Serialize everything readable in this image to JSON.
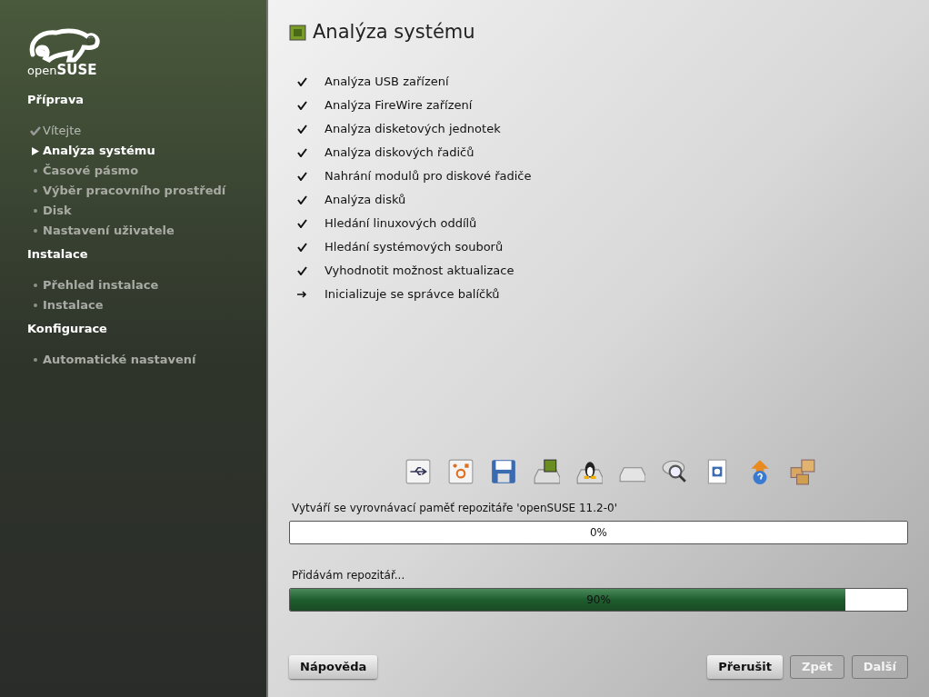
{
  "sidebar": {
    "logo_text": {
      "light": "open",
      "bold": "SUSE"
    },
    "sections": [
      {
        "title": "Příprava",
        "items": [
          {
            "label": "Vítejte",
            "kind": "done"
          },
          {
            "label": "Analýza systému",
            "kind": "current"
          },
          {
            "label": "Časové pásmo",
            "kind": "pending"
          },
          {
            "label": "Výběr pracovního prostředí",
            "kind": "pending"
          },
          {
            "label": "Disk",
            "kind": "pending"
          },
          {
            "label": "Nastavení uživatele",
            "kind": "pending"
          }
        ]
      },
      {
        "title": "Instalace",
        "items": [
          {
            "label": "Přehled instalace",
            "kind": "pending"
          },
          {
            "label": "Instalace",
            "kind": "pending"
          }
        ]
      },
      {
        "title": "Konfigurace",
        "items": [
          {
            "label": "Automatické nastavení",
            "kind": "pending"
          }
        ]
      }
    ]
  },
  "page": {
    "title": "Analýza systému",
    "steps": [
      {
        "label": "Analýza USB zařízení",
        "kind": "done"
      },
      {
        "label": "Analýza FireWire zařízení",
        "kind": "done"
      },
      {
        "label": "Analýza disketových jednotek",
        "kind": "done"
      },
      {
        "label": "Analýza diskových řadičů",
        "kind": "done"
      },
      {
        "label": "Nahrání modulů pro diskové řadiče",
        "kind": "done"
      },
      {
        "label": "Analýza disků",
        "kind": "done"
      },
      {
        "label": "Hledání linuxových oddílů",
        "kind": "done"
      },
      {
        "label": "Hledání systémových souborů",
        "kind": "done"
      },
      {
        "label": "Vyhodnotit možnost aktualizace",
        "kind": "done"
      },
      {
        "label": "Inicializuje se správce balíčků",
        "kind": "current"
      }
    ],
    "progress": [
      {
        "label": "Vytváří se vyrovnávací paměť repozitáře 'openSUSE 11.2-0'",
        "level": 0,
        "reading": "0%"
      },
      {
        "label": "Přidávám repozitář...",
        "level": 0.9,
        "reading": "90%"
      }
    ]
  },
  "buttons": {
    "help": {
      "label": "Nápověda",
      "disabled": false
    },
    "right": [
      {
        "label": "Přerušit",
        "disabled": false
      },
      {
        "label": "Zpět",
        "disabled": true
      },
      {
        "label": "Další",
        "disabled": true
      }
    ]
  }
}
